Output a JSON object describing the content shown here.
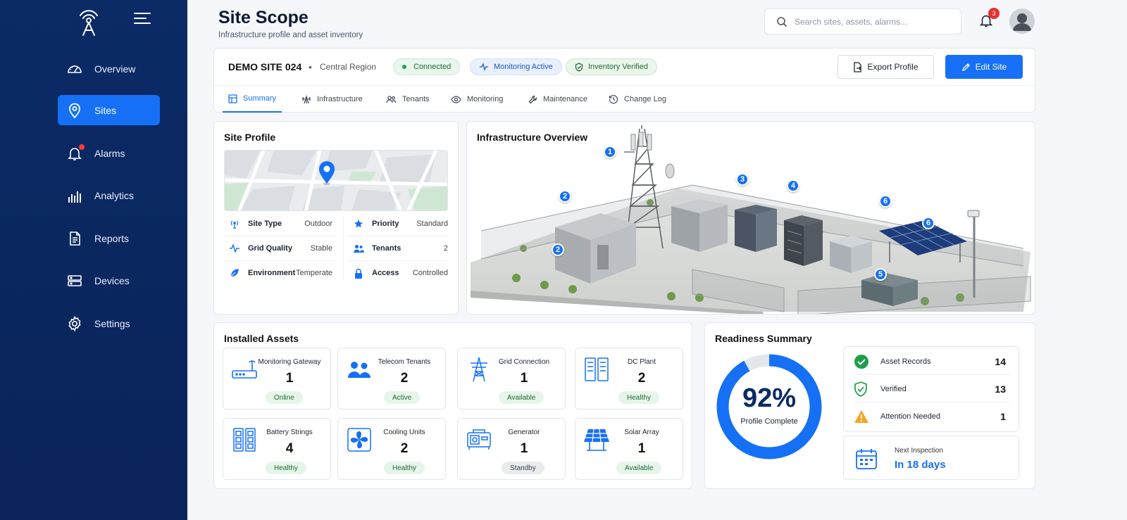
{
  "sidebar": {
    "items": [
      {
        "label": "Overview",
        "icon": "speedometer-icon"
      },
      {
        "label": "Sites",
        "icon": "location-pin-icon"
      },
      {
        "label": "Alarms",
        "icon": "bell-icon"
      },
      {
        "label": "Analytics",
        "icon": "bar-chart-icon"
      },
      {
        "label": "Reports",
        "icon": "document-icon"
      },
      {
        "label": "Devices",
        "icon": "server-icon"
      },
      {
        "label": "Settings",
        "icon": "gear-icon"
      }
    ],
    "active": "Sites"
  },
  "header": {
    "title": "Site Scope",
    "subtitle": "Infrastructure profile and asset inventory",
    "search_placeholder": "Search sites, assets, alarms...",
    "notification_count": "3"
  },
  "site": {
    "name": "DEMO SITE 024",
    "separator": "•",
    "region": "Central Region",
    "badges": {
      "connected": "Connected",
      "monitoring": "Monitoring Active",
      "inventory": "Inventory Verified"
    },
    "export_label": "Export Profile",
    "edit_label": "Edit Site",
    "tabs": [
      "Summary",
      "Infrastructure",
      "Tenants",
      "Monitoring",
      "Maintenance",
      "Change Log"
    ],
    "active_tab": "Summary"
  },
  "profile": {
    "title": "Site Profile",
    "left": [
      {
        "label": "Site Type",
        "value": "Outdoor"
      },
      {
        "label": "Grid Quality",
        "value": "Stable"
      },
      {
        "label": "Environment",
        "value": "Temperate"
      }
    ],
    "right": [
      {
        "label": "Priority",
        "value": "Standard"
      },
      {
        "label": "Tenants",
        "value": "2"
      },
      {
        "label": "Access",
        "value": "Controlled"
      }
    ]
  },
  "infrastructure": {
    "title": "Infrastructure Overview",
    "markers": [
      "1",
      "2",
      "2",
      "3",
      "4",
      "5",
      "6",
      "6"
    ]
  },
  "assets": {
    "title": "Installed Assets",
    "items": [
      {
        "name": "Monitoring Gateway",
        "count": "1",
        "status": "Online"
      },
      {
        "name": "Telecom Tenants",
        "count": "2",
        "status": "Active"
      },
      {
        "name": "Grid Connection",
        "count": "1",
        "status": "Available"
      },
      {
        "name": "DC Plant",
        "count": "2",
        "status": "Healthy"
      },
      {
        "name": "Battery Strings",
        "count": "4",
        "status": "Healthy"
      },
      {
        "name": "Cooling Units",
        "count": "2",
        "status": "Healthy"
      },
      {
        "name": "Generator",
        "count": "1",
        "status": "Standby"
      },
      {
        "name": "Solar Array",
        "count": "1",
        "status": "Available"
      }
    ]
  },
  "readiness": {
    "title": "Readiness Summary",
    "percent_label": "92%",
    "percent_value": 92,
    "caption": "Profile Complete",
    "stats": [
      {
        "label": "Asset Records",
        "value": "14"
      },
      {
        "label": "Verified",
        "value": "13"
      },
      {
        "label": "Attention Needed",
        "value": "1"
      }
    ],
    "next_inspection_label": "Next Inspection",
    "next_inspection_value": "In 18 days"
  },
  "colors": {
    "sidebar_bg": "#0b2a66",
    "accent": "#1670f5",
    "success": "#26a04a",
    "warning": "#f5a623",
    "danger": "#e5312f"
  }
}
